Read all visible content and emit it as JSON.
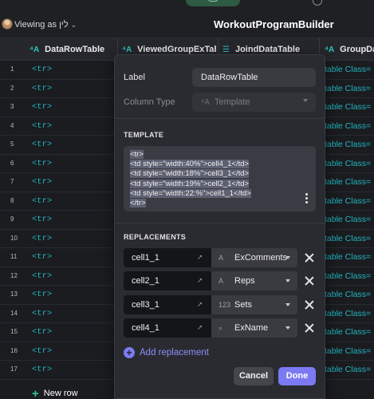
{
  "app": {
    "title": "WorkoutProgramBuilder",
    "viewing_as": "Viewing as לין",
    "colors": {
      "accent": "#7b7af2",
      "teal": "#22b5c0",
      "active_tab": "#2f5a44"
    }
  },
  "table": {
    "columns": [
      {
        "label": "DataRowTable",
        "icon": "template-icon"
      },
      {
        "label": "ViewedGroupExTable",
        "icon": "template-icon"
      },
      {
        "label": "JoindDataTable",
        "icon": "list-icon"
      },
      {
        "label": "GroupData",
        "icon": "template-icon"
      }
    ],
    "rows": [
      {
        "n": "1",
        "c1": "<tr>",
        "c4": "table Class="
      },
      {
        "n": "2",
        "c1": "<tr>",
        "c4": "table Class="
      },
      {
        "n": "3",
        "c1": "<tr>",
        "c4": "table Class="
      },
      {
        "n": "4",
        "c1": "<tr>",
        "c4": "table Class="
      },
      {
        "n": "5",
        "c1": "<tr>",
        "c4": "table Class="
      },
      {
        "n": "6",
        "c1": "<tr>",
        "c4": "table Class="
      },
      {
        "n": "7",
        "c1": "<tr>",
        "c4": "table Class="
      },
      {
        "n": "8",
        "c1": "<tr>",
        "c4": "table Class="
      },
      {
        "n": "9",
        "c1": "<tr>",
        "c4": "table Class="
      },
      {
        "n": "10",
        "c1": "<tr>",
        "c4": "table Class="
      },
      {
        "n": "11",
        "c1": "<tr>",
        "c4": "table Class="
      },
      {
        "n": "12",
        "c1": "<tr>",
        "c4": "table Class="
      },
      {
        "n": "13",
        "c1": "<tr>",
        "c4": "table Class="
      },
      {
        "n": "14",
        "c1": "<tr>",
        "c4": "table Class="
      },
      {
        "n": "15",
        "c1": "<tr>",
        "c4": "table Class="
      },
      {
        "n": "16",
        "c1": "<tr>",
        "c4": "table Class="
      },
      {
        "n": "17",
        "c1": "<tr>",
        "c4": "table Class="
      }
    ],
    "new_row": "New row"
  },
  "modal": {
    "label_caption": "Label",
    "label_value": "DataRowTable",
    "column_type_caption": "Column Type",
    "column_type_value": "Template",
    "template_heading": "TEMPLATE",
    "template_lines": [
      "<tr>",
      "<td style=\"width:40%\">cell4_1</td>",
      "<td style=\"width:18%\">cell3_1</td>",
      "<td style=\"width:19%\">cell2_1</td>",
      "<td style=\"width:22:%\">cell1_1</td>",
      "</tr>"
    ],
    "replacements_heading": "REPLACEMENTS",
    "replacements": [
      {
        "key": "cell1_1",
        "type_icon": "text-icon",
        "type_symbol": "A",
        "value": "ExComments"
      },
      {
        "key": "cell2_1",
        "type_icon": "text-icon",
        "type_symbol": "A",
        "value": "Reps"
      },
      {
        "key": "cell3_1",
        "type_icon": "number-icon",
        "type_symbol": "123",
        "value": "Sets"
      },
      {
        "key": "cell4_1",
        "type_icon": "lookup-icon",
        "type_symbol": "⌕",
        "value": "ExName"
      }
    ],
    "add_replacement": "Add replacement",
    "cancel": "Cancel",
    "done": "Done"
  }
}
